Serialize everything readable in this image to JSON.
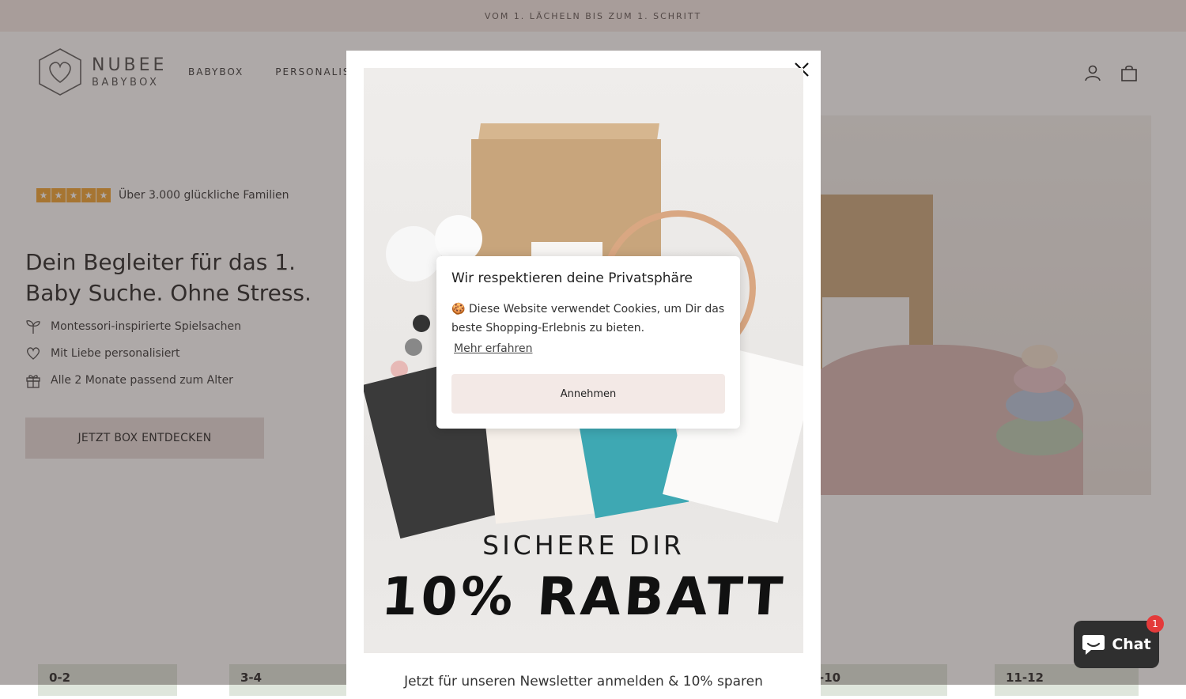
{
  "announcement": "VOM 1. LÄCHELN BIS ZUM 1. SCHRITT",
  "header": {
    "logo_line1": "NUBEE",
    "logo_line2": "BABYBOX",
    "nav": [
      "BABYBOX",
      "PERSONALIS"
    ],
    "icons": [
      "account-icon",
      "shopping-bag-icon"
    ]
  },
  "hero": {
    "rating_text": "Über 3.000 glückliche Familien",
    "rating_stars": 5,
    "title": "Dein Begleiter für das 1. Baby Suche. Ohne Stress.",
    "features": [
      {
        "icon": "sprout-icon",
        "label": "Montessori-inspirierte Spielsachen"
      },
      {
        "icon": "heart-icon",
        "label": "Mit Liebe personalisiert"
      },
      {
        "icon": "gift-icon",
        "label": "Alle 2 Monate passend zum Alter"
      }
    ],
    "cta_label": "JETZT BOX ENTDECKEN"
  },
  "age_cards": [
    "0-2",
    "3-4",
    "-10",
    "11-12"
  ],
  "modal": {
    "promo_line1": "SICHERE DIR",
    "promo_line2": "10% RABATT",
    "subtitle": "Jetzt für unseren Newsletter anmelden & 10% sparen"
  },
  "cookie": {
    "title": "Wir respektieren deine Privatsphäre",
    "text": "🍪 Diese Website verwendet Cookies, um Dir das beste Shopping-Erlebnis zu bieten.",
    "link": "Mehr erfahren",
    "accept": "Annehmen"
  },
  "chat": {
    "label": "Chat",
    "badge": "1"
  },
  "colors": {
    "announcement_bg": "#f5e9e6",
    "cta_bg": "#e7dcd9",
    "star": "#f0a32e",
    "chat_bg": "#2f2f2f",
    "badge": "#e43a3a",
    "accept_bg": "#f3e9e6"
  }
}
